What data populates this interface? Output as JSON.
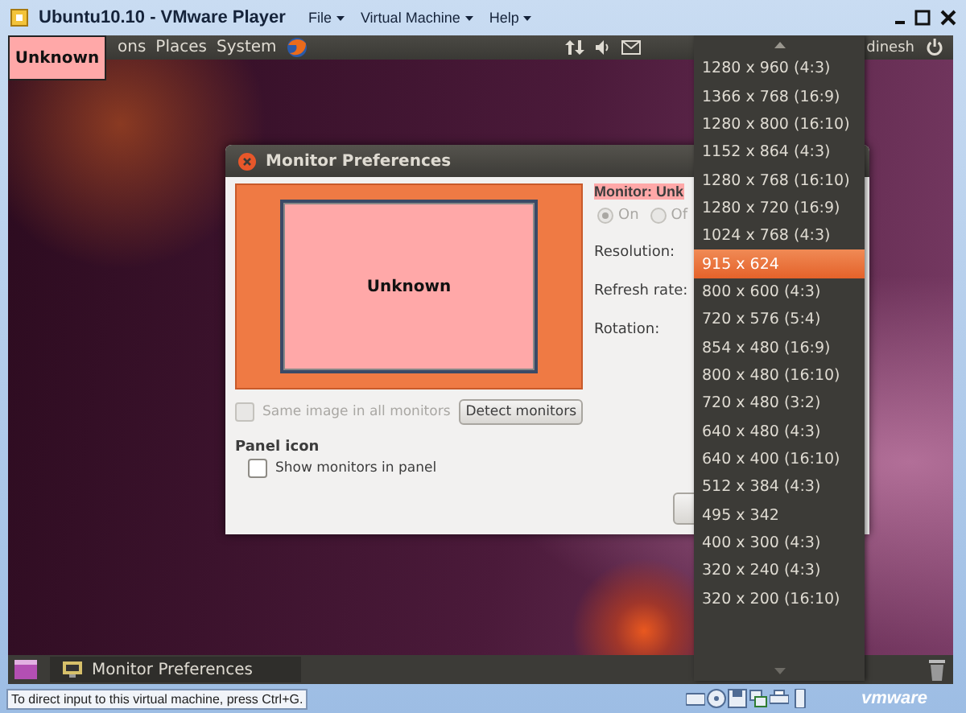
{
  "window": {
    "title": "Ubuntu10.10 - VMware Player",
    "menus": [
      {
        "label": "File"
      },
      {
        "label": "Virtual Machine"
      },
      {
        "label": "Help"
      }
    ]
  },
  "overlay_label": "Unknown",
  "top_panel": {
    "menus": [
      "ons",
      "Places",
      "System"
    ],
    "user": "dinesh"
  },
  "dialog": {
    "title": "Monitor Preferences",
    "monitor_label": "Unknown",
    "same_image": {
      "label": "Same image in all monitors",
      "checked": false,
      "disabled": true
    },
    "detect_button": "Detect monitors",
    "panel_icon_heading": "Panel icon",
    "show_monitors": {
      "label": "Show monitors in panel",
      "checked": false,
      "disabled": false
    },
    "monitor_name": "Monitor: Unk",
    "power": [
      {
        "label": "On",
        "selected": true
      },
      {
        "label": "Of",
        "selected": false
      }
    ],
    "fields": [
      "Resolution:",
      "Refresh rate:",
      "Rotation:"
    ]
  },
  "resolution_menu": {
    "items": [
      {
        "label": "1280 x 960 (4:3)",
        "selected": false
      },
      {
        "label": "1366 x 768 (16:9)",
        "selected": false
      },
      {
        "label": "1280 x 800 (16:10)",
        "selected": false
      },
      {
        "label": "1152 x 864 (4:3)",
        "selected": false
      },
      {
        "label": "1280 x 768 (16:10)",
        "selected": false
      },
      {
        "label": "1280 x 720 (16:9)",
        "selected": false
      },
      {
        "label": "1024 x 768 (4:3)",
        "selected": false
      },
      {
        "label": "915 x 624",
        "selected": true
      },
      {
        "label": "800 x 600 (4:3)",
        "selected": false
      },
      {
        "label": "720 x 576 (5:4)",
        "selected": false
      },
      {
        "label": "854 x 480 (16:9)",
        "selected": false
      },
      {
        "label": "800 x 480 (16:10)",
        "selected": false
      },
      {
        "label": "720 x 480 (3:2)",
        "selected": false
      },
      {
        "label": "640 x 480 (4:3)",
        "selected": false
      },
      {
        "label": "640 x 400 (16:10)",
        "selected": false
      },
      {
        "label": "512 x 384 (4:3)",
        "selected": false
      },
      {
        "label": "495 x 342",
        "selected": false
      },
      {
        "label": "400 x 300 (4:3)",
        "selected": false
      },
      {
        "label": "320 x 240 (4:3)",
        "selected": false
      },
      {
        "label": "320 x 200 (16:10)",
        "selected": false
      }
    ]
  },
  "bottom_panel": {
    "tasks": [
      {
        "label": "Monitor Preferences"
      }
    ]
  },
  "status_bar": {
    "hint": "To direct input to this virtual machine, press Ctrl+G.",
    "logo": "vmware"
  }
}
